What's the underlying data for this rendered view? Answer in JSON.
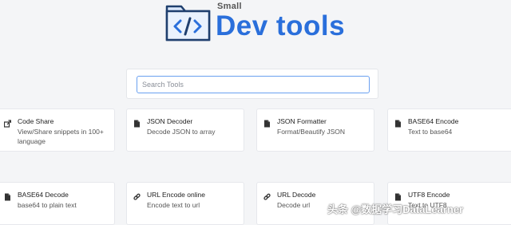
{
  "logo": {
    "small": "Small",
    "title": "Dev tools"
  },
  "search": {
    "placeholder": "Search Tools",
    "value": ""
  },
  "tools": [
    {
      "title": "Code Share",
      "desc": "View/Share snippets in 100+ language",
      "icon": "share-icon"
    },
    {
      "title": "JSON Decoder",
      "desc": "Decode JSON to array",
      "icon": "file-icon"
    },
    {
      "title": "JSON Formatter",
      "desc": "Format/Beautify JSON",
      "icon": "file-icon"
    },
    {
      "title": "BASE64 Encode",
      "desc": "Text to base64",
      "icon": "file-icon"
    },
    {
      "title": "BASE64 Decode",
      "desc": "base64 to plain text",
      "icon": "file-icon"
    },
    {
      "title": "URL Encode online",
      "desc": "Encode text to url",
      "icon": "link-icon"
    },
    {
      "title": "URL Decode",
      "desc": "Decode url",
      "icon": "link-icon"
    },
    {
      "title": "UTF8 Encode",
      "desc": "Text to UTF8",
      "icon": "file-icon"
    }
  ],
  "watermark": "头条 @数据学习DataLearner",
  "colors": {
    "brand": "#2a6fdb",
    "search_focus": "#6aa0f0",
    "background": "#f4f5f7"
  }
}
